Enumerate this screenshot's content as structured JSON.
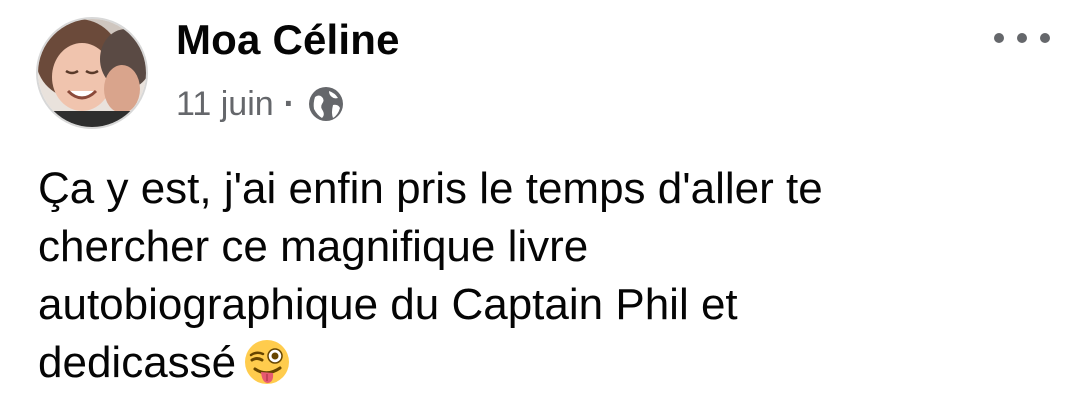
{
  "post": {
    "author": "Moa Céline",
    "date": "11 juin",
    "separator": "·",
    "privacy_icon": "globe-icon",
    "more_icon": "more-horizontal-icon",
    "text_lines": [
      "Ça y est, j'ai enfin pris le temps d'aller te",
      "chercher ce magnifique livre",
      "autobiographique du Captain Phil et",
      "dedicassé"
    ],
    "emoji": "winking-face-with-tongue-emoji"
  },
  "colors": {
    "text_primary": "#050505",
    "text_secondary": "#65676b",
    "background": "#ffffff",
    "emoji_yellow": "#ffcc4d"
  }
}
